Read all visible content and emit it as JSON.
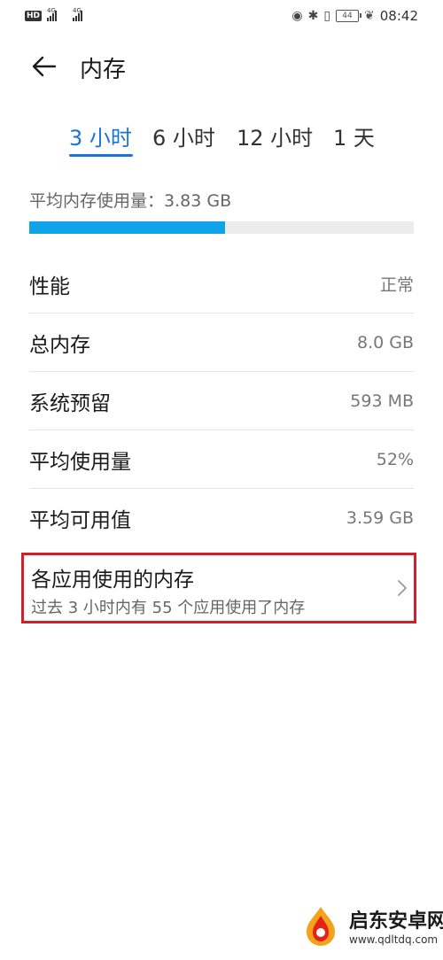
{
  "status_bar": {
    "hd": "HD",
    "net1": "4G",
    "net2": "4G",
    "battery": "44",
    "time": "08:42"
  },
  "header": {
    "title": "内存",
    "back_icon": "arrow-left-icon"
  },
  "tabs": [
    {
      "label": "3 小时",
      "active": true
    },
    {
      "label": "6 小时",
      "active": false
    },
    {
      "label": "12 小时",
      "active": false
    },
    {
      "label": "1 天",
      "active": false
    }
  ],
  "average": {
    "label": "平均内存使用量：3.83 GB",
    "fraction": 0.51
  },
  "rows": [
    {
      "label": "性能",
      "value": "正常"
    },
    {
      "label": "总内存",
      "value": "8.0 GB"
    },
    {
      "label": "系统预留",
      "value": "593 MB"
    },
    {
      "label": "平均使用量",
      "value": "52%"
    },
    {
      "label": "平均可用值",
      "value": "3.59 GB"
    }
  ],
  "app_memory": {
    "title": "各应用使用的内存",
    "subtitle": "过去 3 小时内有 55 个应用使用了内存"
  },
  "watermark": {
    "title": "启东安卓网",
    "url": "www.qdltdq.com"
  },
  "colors": {
    "accent": "#1a73d9",
    "progress": "#0fa3e8",
    "highlight_border": "#d0202a"
  }
}
